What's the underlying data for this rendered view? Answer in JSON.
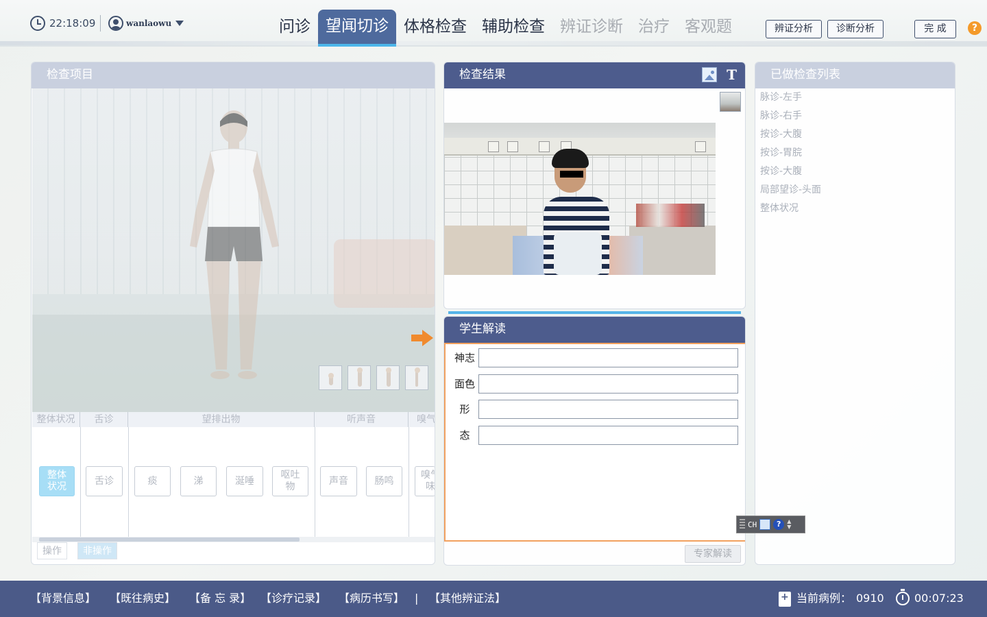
{
  "header": {
    "time": "22:18:09",
    "username": "wanlaowu",
    "tabs": [
      {
        "label": "问诊",
        "state": "normal"
      },
      {
        "label": "望闻切诊",
        "state": "active"
      },
      {
        "label": "体格检查",
        "state": "normal"
      },
      {
        "label": "辅助检查",
        "state": "normal"
      },
      {
        "label": "辨证诊断",
        "state": "disabled"
      },
      {
        "label": "治疗",
        "state": "disabled"
      },
      {
        "label": "客观题",
        "state": "disabled"
      }
    ],
    "syndrome_btn": "辨证分析",
    "diagnosis_btn": "诊断分析",
    "finish_btn": "完 成",
    "help": "?"
  },
  "left_panel": {
    "title": "检查项目",
    "categories": [
      "整体状况",
      "舌诊",
      "望排出物",
      "听声音",
      "嗅气"
    ],
    "options": [
      {
        "label": "整体\n状况",
        "selected": true
      },
      {
        "label": "舌诊",
        "selected": false
      },
      {
        "label": "痰",
        "selected": false
      },
      {
        "label": "涕",
        "selected": false
      },
      {
        "label": "涎唾",
        "selected": false
      },
      {
        "label": "呕吐\n物",
        "selected": false
      },
      {
        "label": "声音",
        "selected": false
      },
      {
        "label": "肠鸣",
        "selected": false
      },
      {
        "label": "嗅气\n味",
        "selected": false
      }
    ],
    "mode_operate": "操作",
    "mode_non_operate": "非操作"
  },
  "result_panel": {
    "title": "检查结果"
  },
  "interpretation_panel": {
    "title": "学生解读",
    "fields": [
      {
        "label": "神志",
        "value": ""
      },
      {
        "label": "面色",
        "value": ""
      },
      {
        "label": "形",
        "value": ""
      },
      {
        "label": "态",
        "value": ""
      }
    ],
    "expert_btn": "专家解读"
  },
  "done_panel": {
    "title": "已做检查列表",
    "items": [
      "脉诊-左手",
      "脉诊-右手",
      "按诊-大腹",
      "按诊-胃脘",
      "按诊-大腹",
      "局部望诊-头面",
      "整体状况"
    ]
  },
  "ime": {
    "text": "CH",
    "help": "?"
  },
  "footer": {
    "links": [
      "【背景信息】",
      "【既往病史】",
      "【备 忘 录】",
      "【诊疗记录】",
      "【病历书写】",
      "|",
      "【其他辨证法】"
    ],
    "case_label": "当前病例：",
    "case_number": "0910",
    "elapsed": "00:07:23"
  },
  "colors": {
    "tab_active": "#4e6a9d",
    "tab_underline": "#4cb6ea",
    "panel_header_dark": "#4d5c8d",
    "footer_bg": "#4b5a88",
    "accent_orange": "#f08a2e",
    "help_orange": "#f49a2a"
  }
}
